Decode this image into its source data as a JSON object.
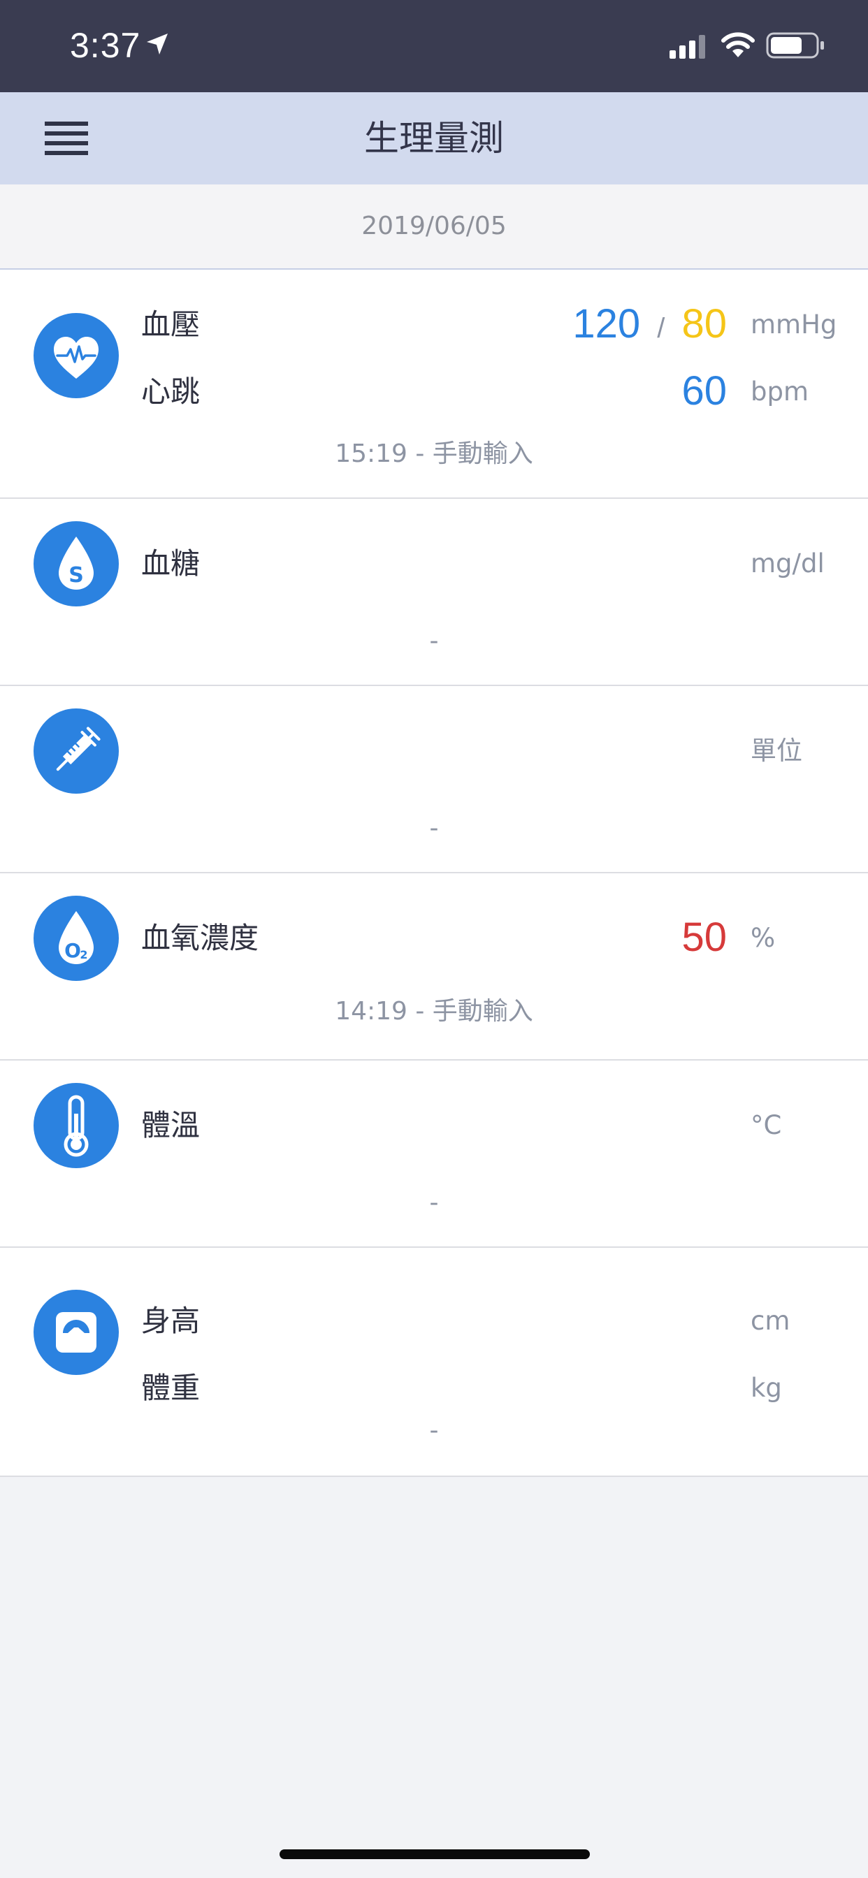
{
  "status_bar": {
    "time": "3:37"
  },
  "nav": {
    "title": "生理量測"
  },
  "date": "2019/06/05",
  "cards": {
    "blood_pressure": {
      "icon": "heart-pulse-icon",
      "label_bp": "血壓",
      "systolic": "120",
      "separator": "/",
      "diastolic": "80",
      "unit_bp": "mmHg",
      "label_hr": "心跳",
      "heart_rate": "60",
      "unit_hr": "bpm",
      "meta": "15:19 - 手動輸入"
    },
    "blood_sugar": {
      "icon": "glucose-drop-icon",
      "label": "血糖",
      "unit": "mg/dl",
      "meta": "-"
    },
    "insulin": {
      "icon": "syringe-icon",
      "unit": "單位",
      "meta": "-"
    },
    "oxygen": {
      "icon": "oxygen-drop-icon",
      "label": "血氧濃度",
      "value": "50",
      "unit": "%",
      "meta": "14:19 - 手動輸入"
    },
    "temperature": {
      "icon": "thermometer-icon",
      "label": "體溫",
      "unit": "°C",
      "meta": "-"
    },
    "body": {
      "icon": "scale-icon",
      "label_height": "身高",
      "unit_height": "cm",
      "label_weight": "體重",
      "unit_weight": "kg",
      "meta": "-"
    }
  },
  "colors": {
    "accent_blue": "#2b82e0",
    "diastolic_yellow": "#f5c518",
    "oxygen_red": "#d63a3a"
  }
}
